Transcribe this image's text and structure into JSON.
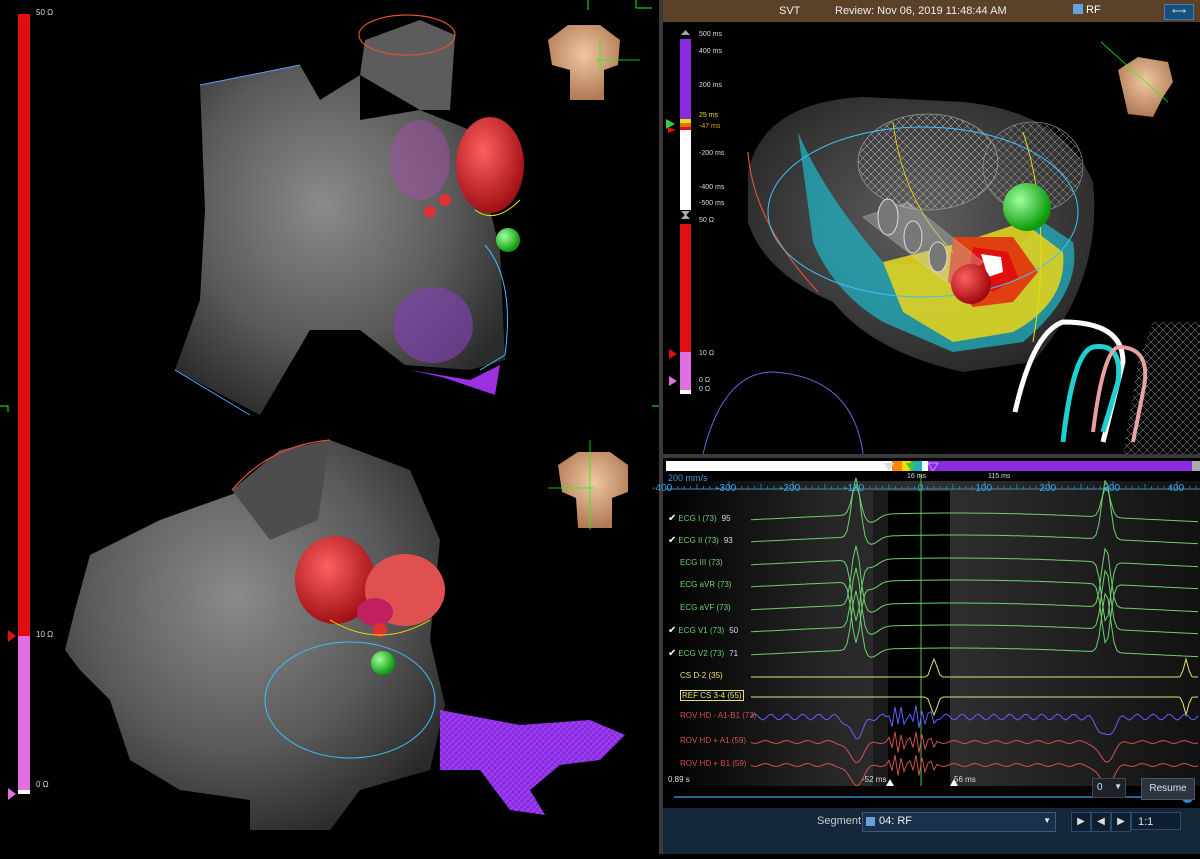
{
  "left_panel": {
    "impedance_scale": {
      "top": "50 Ω",
      "mid": "10 Ω",
      "bottom": "0 Ω"
    }
  },
  "right_panel": {
    "title": {
      "mode": "SVT",
      "review": "Review: Nov 06, 2019 11:48:44 AM",
      "rf": "RF"
    },
    "lat_scale": [
      "500 ms",
      "400 ms",
      "200 ms",
      "25 ms",
      "-47 ms",
      "-200 ms",
      "-400 ms",
      "-500 ms"
    ],
    "imp_scale": {
      "top": "50 Ω",
      "mid": "10 Ω",
      "bottom1": "0 Ω",
      "bottom2": "0 Ω"
    }
  },
  "egm": {
    "speed": "200 mm/s",
    "axis_ticks": [
      "-400",
      "-300",
      "-200",
      "-100",
      "0",
      "100",
      "200",
      "300",
      "400"
    ],
    "window_marks": {
      "left": "16 ms",
      "right": "115 ms"
    },
    "channels": [
      {
        "label": "ECG I (73)",
        "value": "95",
        "checked": true,
        "color": "#6fd06f"
      },
      {
        "label": "ECG II (73)",
        "value": "93",
        "checked": true,
        "color": "#6fd06f"
      },
      {
        "label": "ECG III (73)",
        "value": "",
        "checked": false,
        "color": "#6fd06f"
      },
      {
        "label": "ECG aVR (73)",
        "value": "",
        "checked": false,
        "color": "#6fd06f"
      },
      {
        "label": "ECG aVF (73)",
        "value": "",
        "checked": false,
        "color": "#6fd06f"
      },
      {
        "label": "ECG V1 (73)",
        "value": "50",
        "checked": true,
        "color": "#6fd06f"
      },
      {
        "label": "ECG V2 (73)",
        "value": "71",
        "checked": true,
        "color": "#6fd06f"
      },
      {
        "label": "CS  D-2 (35)",
        "value": "",
        "checked": false,
        "color": "#e8e070"
      },
      {
        "label": "REF CS  3-4 (55)",
        "value": "",
        "checked": false,
        "color": "#e8e070"
      },
      {
        "label": "ROV HD - A1-B1 (73)",
        "value": "",
        "checked": false,
        "color": "#d05050"
      },
      {
        "label": "ROV HD + A1 (59)",
        "value": "",
        "checked": false,
        "color": "#d05050"
      },
      {
        "label": "ROV HD + B1 (59)",
        "value": "",
        "checked": false,
        "color": "#d05050"
      }
    ],
    "bottom_labels": {
      "gain": "0.89 s",
      "left_ms": "-52 ms",
      "right_ms": "56 ms"
    }
  },
  "controls": {
    "gain_value": "0",
    "resume": "Resume",
    "segment_label": "Segment",
    "segment_value": "04: RF",
    "speed": "1:1"
  },
  "colors": {
    "impedance_red": "#e01010",
    "impedance_pink": "#e070e0",
    "lat_purple": "#8a2be2",
    "title_bar": "#5a4128",
    "ecg_green": "#6fd06f",
    "cs_yellow": "#e8e070"
  }
}
